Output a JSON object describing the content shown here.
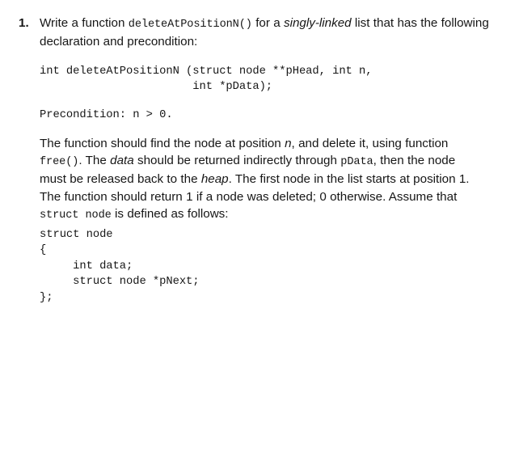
{
  "document": {
    "clipped_header_fragment": "",
    "question": {
      "number": "1.",
      "intro_line": {
        "part1": "Write a function ",
        "code1": "deleteAtPositionN()",
        "part2": " for a ",
        "em1": "singly-linked",
        "part3": " list that has the following declaration and precondition:"
      },
      "declaration_code": "int deleteAtPositionN (struct node **pHead, int n,\n                       int *pData);",
      "precondition_code": "Precondition: n > 0.",
      "description": {
        "s1": "The function should find the node at position ",
        "em_n": "n",
        "s2": ", and delete it, using function ",
        "code_free": "free()",
        "s3": ". The ",
        "em_data": "data",
        "s4": " should be returned indirectly through ",
        "code_pdata": "pData",
        "s5": ", then the node must be released back to the ",
        "em_heap": "heap",
        "s6": ". The first node in the list starts at position 1. The function should return 1 if a node was deleted; 0 otherwise. Assume that ",
        "code_struct": "struct node",
        "s7": " is defined as follows:"
      },
      "struct_code": "struct node\n{\n     int data;\n     struct node *pNext;\n};"
    }
  },
  "colors": {
    "page_background": "#ffffff",
    "text": "#161616"
  }
}
